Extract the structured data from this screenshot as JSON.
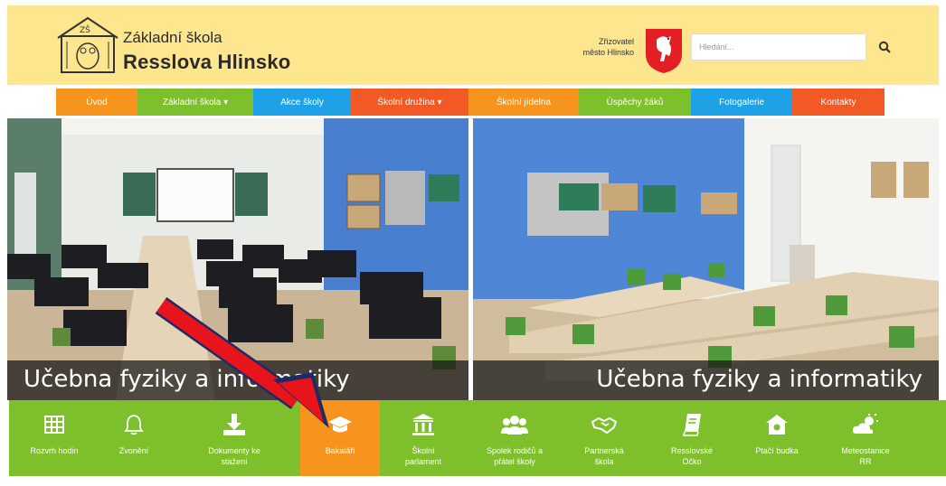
{
  "header": {
    "school_line1": "Základní škola",
    "school_line2": "Resslova Hlinsko",
    "founder_label": "Zřizovatel",
    "founder_name": "město Hlinsko",
    "search_placeholder": "Hledání..."
  },
  "nav": [
    {
      "label": "Úvod",
      "color": "#f7941d"
    },
    {
      "label": "Základní škola ▾",
      "color": "#7dc02c"
    },
    {
      "label": "Akce školy",
      "color": "#1ea1e6"
    },
    {
      "label": "Školní družina ▾",
      "color": "#f15a24"
    },
    {
      "label": "Školní jídelna",
      "color": "#f7941d"
    },
    {
      "label": "Úspěchy žáků",
      "color": "#7dc02c"
    },
    {
      "label": "Fotogalerie",
      "color": "#1ea1e6"
    },
    {
      "label": "Kontakty",
      "color": "#f15a24"
    }
  ],
  "slides": [
    {
      "caption": "Učebna fyziky a informatiky"
    },
    {
      "caption": "Učebna fyziky a informatiky"
    }
  ],
  "tiles": [
    {
      "label": "Rozvrh hodin",
      "icon": "table-icon"
    },
    {
      "label": "Zvonění",
      "icon": "bell-icon"
    },
    {
      "label": "Dokumenty ke\nstažení",
      "icon": "download-icon"
    },
    {
      "label": "Bakaláři",
      "icon": "graduation-cap-icon",
      "active": true
    },
    {
      "label": "Školní\nparlament",
      "icon": "institution-icon"
    },
    {
      "label": "Spolek rodičů a\npřátel školy",
      "icon": "users-icon"
    },
    {
      "label": "Partnerská\nškola",
      "icon": "handshake-icon"
    },
    {
      "label": "Resslovské\nOčko",
      "icon": "book-icon"
    },
    {
      "label": "Ptačí budka",
      "icon": "birdhouse-icon"
    },
    {
      "label": "Meteostanice\nRR",
      "icon": "weather-icon"
    }
  ],
  "colors": {
    "header_bg": "#fde68d",
    "tile_bg": "#7dc02c",
    "tile_active": "#f7941d",
    "arrow": "#e8141c"
  }
}
